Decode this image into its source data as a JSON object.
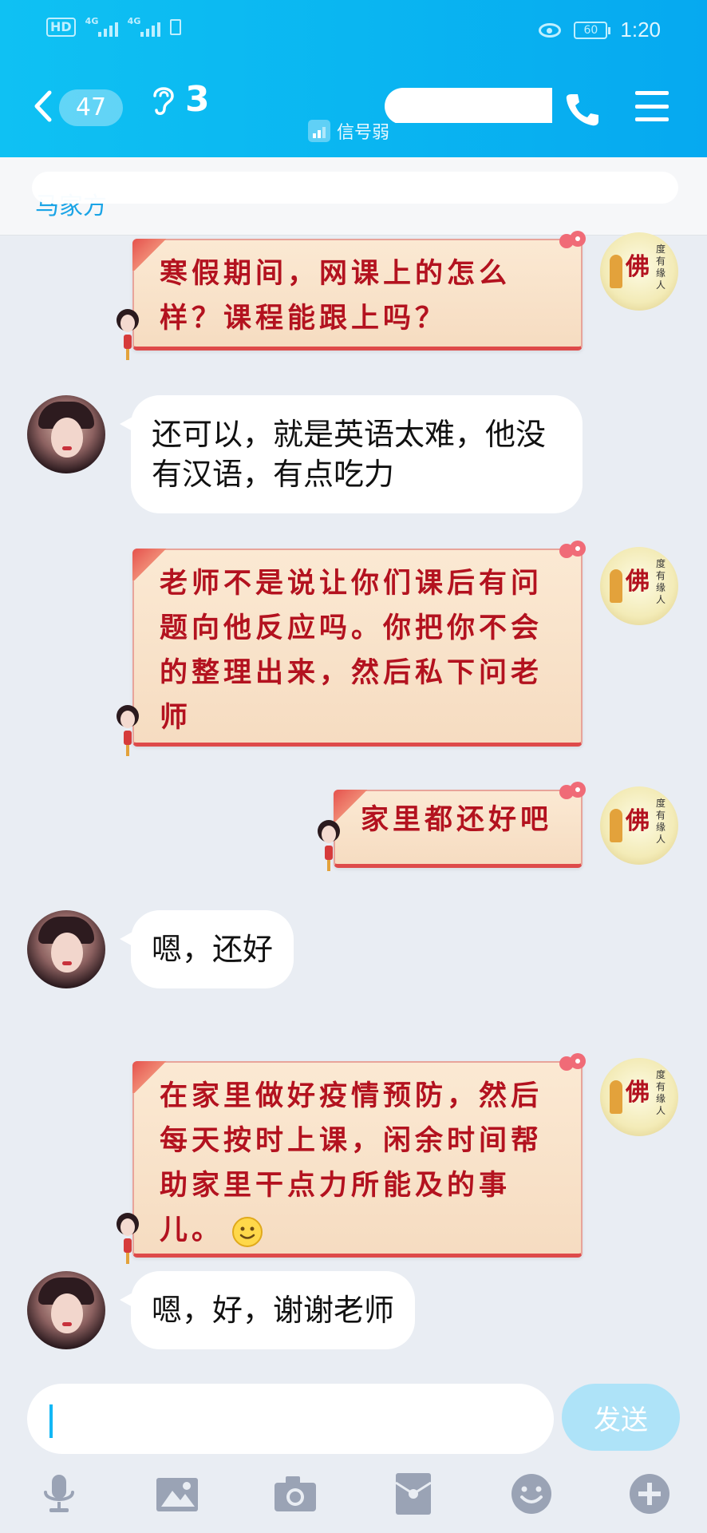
{
  "status_bar": {
    "hd": "HD",
    "net1": "4G",
    "net2": "4G",
    "battery": "60",
    "time": "1:20"
  },
  "header": {
    "back_count": "47",
    "title": "3",
    "signal_text": "信号弱"
  },
  "notice": {
    "text": "马家方"
  },
  "messages": [
    {
      "side": "right",
      "style": "card",
      "text": "寒假期间，网课上的怎么样？课程能跟上吗？"
    },
    {
      "side": "left",
      "style": "bubble",
      "text": "还可以，就是英语太难，他没有汉语，有点吃力"
    },
    {
      "side": "right",
      "style": "card",
      "text": "老师不是说让你们课后有问题向他反应吗。你把你不会的整理出来，然后私下问老师"
    },
    {
      "side": "right",
      "style": "card",
      "text": "家里都还好吧"
    },
    {
      "side": "left",
      "style": "bubble",
      "text": "嗯，还好"
    },
    {
      "side": "right",
      "style": "card",
      "text": "在家里做好疫情预防，然后每天按时上课，闲余时间帮助家里干点力所能及的事儿。",
      "emoji": "smile-emoji"
    },
    {
      "side": "left",
      "style": "bubble",
      "text": "嗯，好，谢谢老师"
    }
  ],
  "avatar_right": {
    "main": "佛",
    "sub": "度有缘人"
  },
  "input": {
    "placeholder": "",
    "send_label": "发送"
  },
  "toolbar": [
    "mic-icon",
    "image-icon",
    "camera-icon",
    "red-packet-icon",
    "emoji-icon",
    "plus-icon"
  ],
  "colors": {
    "header": "#0ab6f1",
    "card_text": "#b3121f",
    "accent": "#12b7f5"
  }
}
